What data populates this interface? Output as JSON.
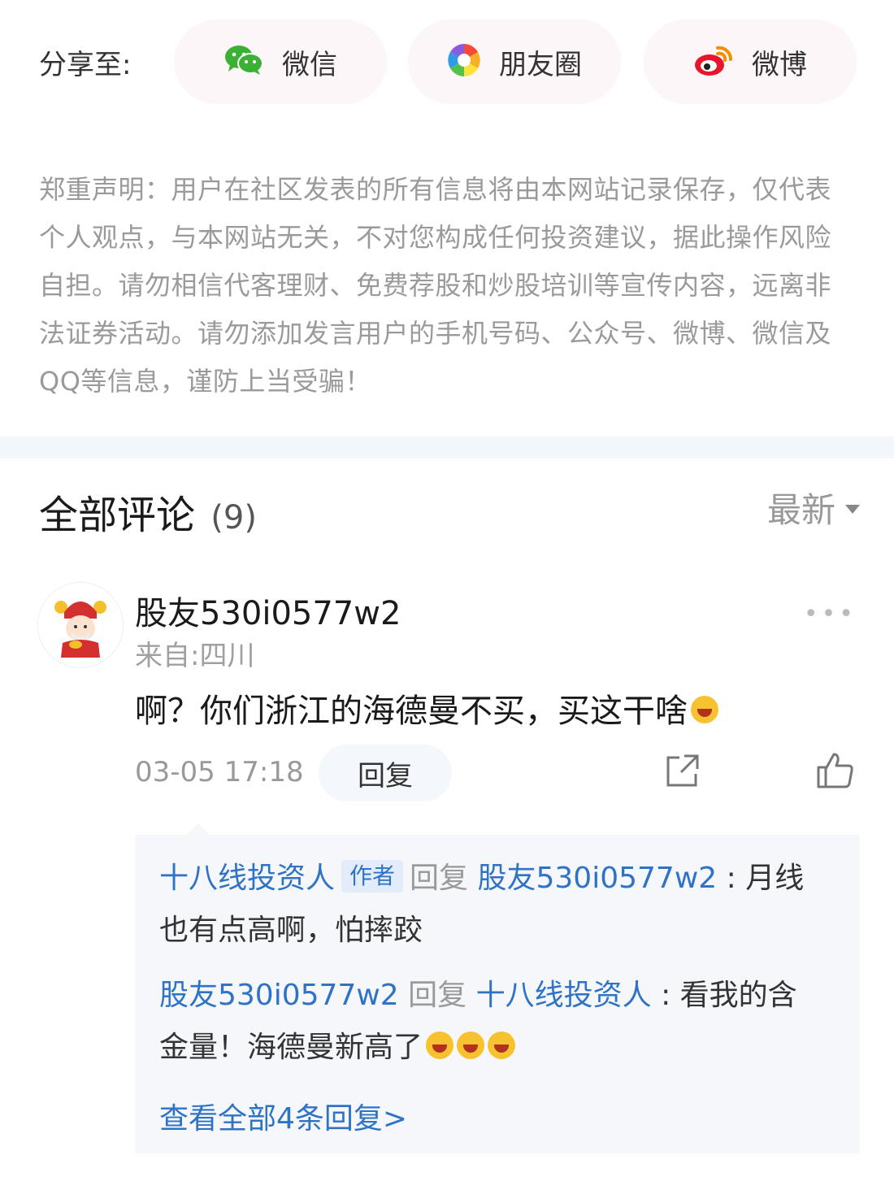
{
  "share": {
    "label": "分享至:",
    "options": [
      {
        "label": "微信",
        "icon": "wechat-icon"
      },
      {
        "label": "朋友圈",
        "icon": "moments-icon"
      },
      {
        "label": "微博",
        "icon": "weibo-icon"
      }
    ]
  },
  "disclaimer": "郑重声明：用户在社区发表的所有信息将由本网站记录保存，仅代表个人观点，与本网站无关，不对您构成任何投资建议，据此操作风险自担。请勿相信代客理财、免费荐股和炒股培训等宣传内容，远离非法证券活动。请勿添加发言用户的手机号码、公众号、微博、微信及QQ等信息，谨防上当受骗！",
  "comments": {
    "title": "全部评论",
    "count": "(9)",
    "sort": "最新"
  },
  "comment": {
    "username": "股友530i0577w2",
    "location": "来自:四川",
    "text": "啊？你们浙江的海德曼不买，买这干啥",
    "time": "03-05 17:18",
    "reply_label": "回复",
    "more": "•••",
    "replies": [
      {
        "from": "十八线投资人",
        "badge": "作者",
        "action": "回复",
        "to": "股友530i0577w2",
        "sep": ":",
        "text": "月线也有点高啊，怕摔跤"
      },
      {
        "from": "股友530i0577w2",
        "action": "回复",
        "to": "十八线投资人",
        "sep": ":",
        "text": "看我的含金量！海德曼新高了"
      }
    ],
    "view_all": "查看全部4条回复>"
  }
}
